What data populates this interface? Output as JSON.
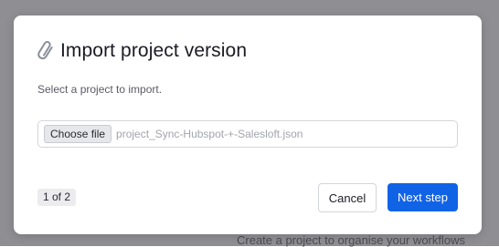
{
  "background": {
    "hint_text": "Create a project to organise your workflows"
  },
  "modal": {
    "icon": "paperclip-icon",
    "title": "Import project version",
    "subtitle": "Select a project to import.",
    "file_input": {
      "button_label": "Choose file",
      "file_name": "project_Sync-Hubspot-+-Salesloft.json"
    },
    "step_indicator": "1 of 2",
    "cancel_label": "Cancel",
    "next_label": "Next step"
  },
  "colors": {
    "primary": "#1163e6",
    "backdrop": "#8e8e93"
  }
}
